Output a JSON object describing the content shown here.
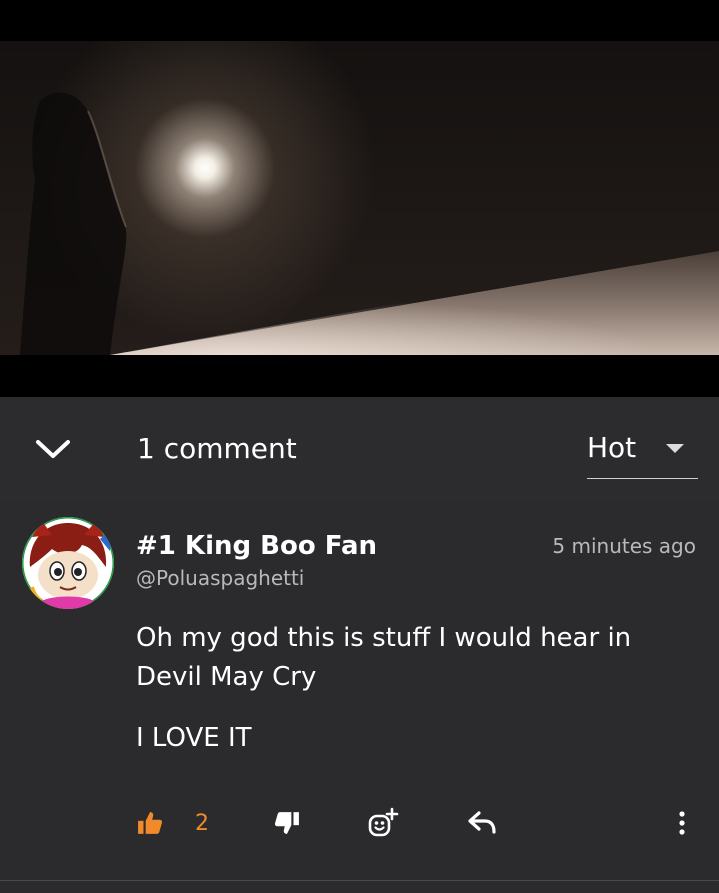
{
  "header": {
    "comment_count": "1 comment",
    "sort": {
      "selected": "Hot"
    }
  },
  "comment": {
    "author_name": "#1 King Boo Fan",
    "author_handle": "@Poluaspaghetti",
    "timestamp": "5 minutes ago",
    "body": [
      "Oh my god this is stuff I would hear in Devil May Cry",
      "I LOVE IT"
    ],
    "actions": {
      "like_count": "2",
      "like_icon": "thumbs-up-icon",
      "dislike_icon": "thumbs-down-icon",
      "react_icon": "add-reaction-icon",
      "reply_icon": "reply-icon",
      "more_icon": "more-vertical-icon"
    }
  },
  "colors": {
    "background": "#2b2a2d",
    "accent": "#f08a2a",
    "muted_text": "#b9b9bc"
  }
}
